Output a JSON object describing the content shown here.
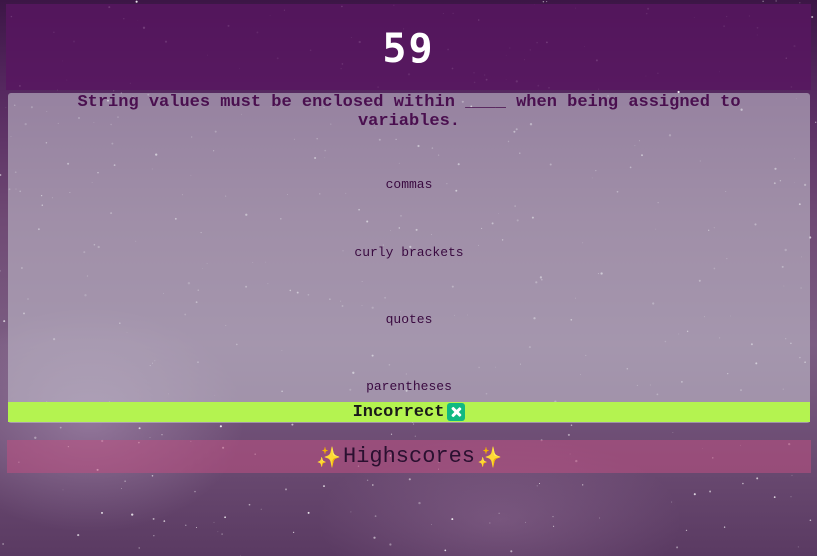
{
  "timer": {
    "value": "59"
  },
  "quiz": {
    "question": "String values must be enclosed within ____ when being assigned to variables.",
    "choices": [
      "commas",
      "curly brackets",
      "quotes",
      "parentheses"
    ]
  },
  "feedback": {
    "text": "Incorrect",
    "icon": "cross-mark-icon",
    "color": "#b4f350"
  },
  "highscores": {
    "label": "Highscores",
    "icon": "sparkles-icon"
  },
  "colors": {
    "header": "#58165f",
    "question_text": "#4a0f4f",
    "highscores_bg": "#be5082"
  }
}
